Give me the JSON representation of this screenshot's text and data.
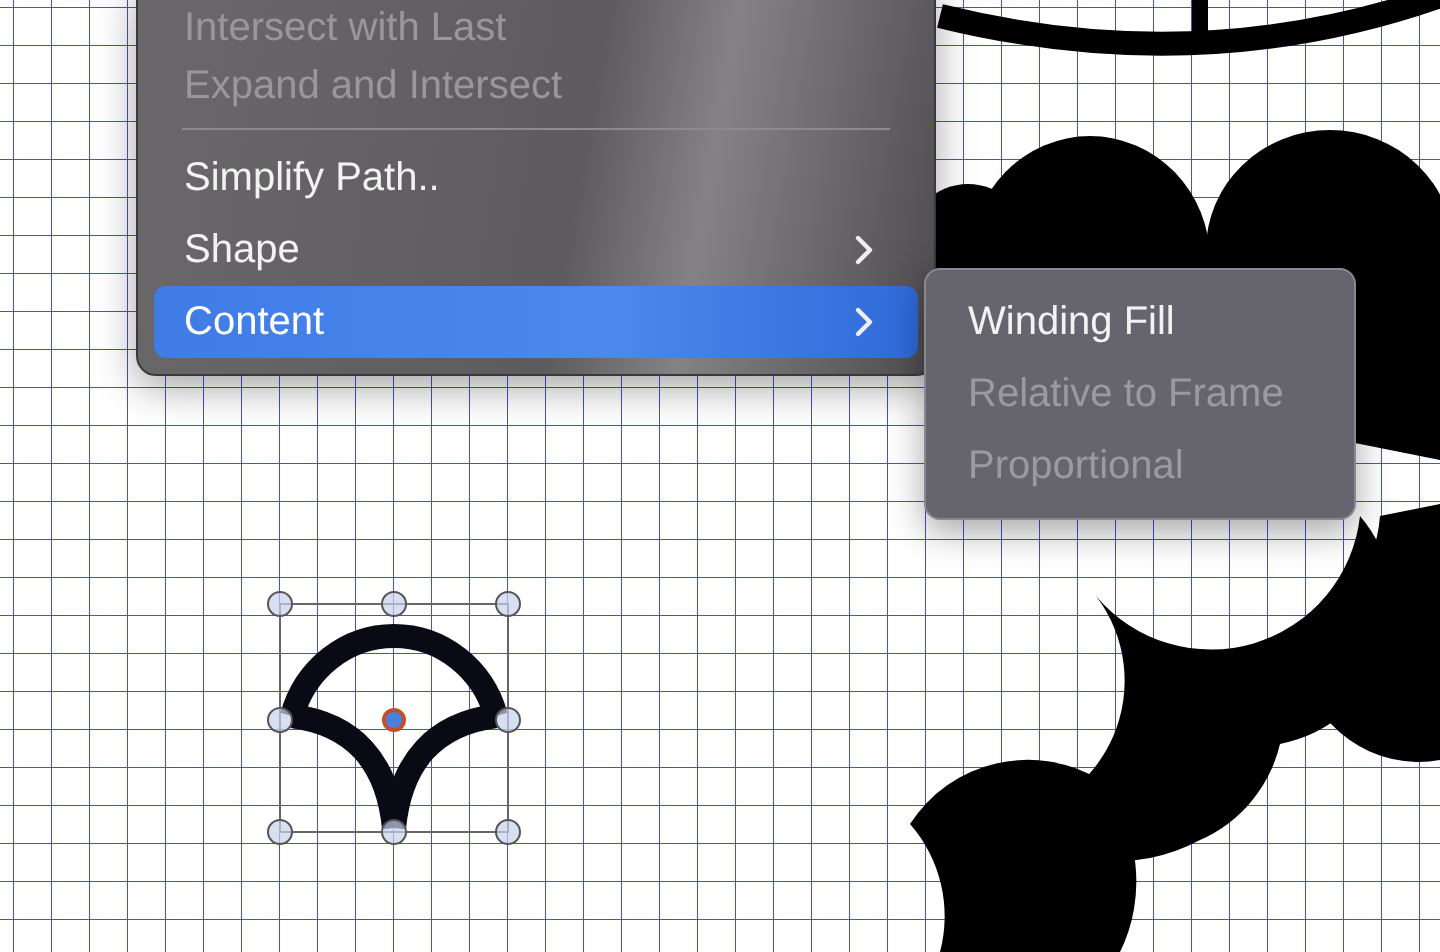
{
  "menu": {
    "items": [
      {
        "kind": "item",
        "label": "Intersect with Last",
        "disabled": true,
        "selected": false,
        "submenu": false
      },
      {
        "kind": "item",
        "label": "Expand and Intersect",
        "disabled": true,
        "selected": false,
        "submenu": false
      },
      {
        "kind": "separator"
      },
      {
        "kind": "item",
        "label": "Simplify Path..",
        "disabled": false,
        "selected": false,
        "submenu": false
      },
      {
        "kind": "item",
        "label": "Shape",
        "disabled": false,
        "selected": false,
        "submenu": true
      },
      {
        "kind": "item",
        "label": "Content",
        "disabled": false,
        "selected": true,
        "submenu": true
      }
    ]
  },
  "submenu": {
    "items": [
      {
        "label": "Winding Fill",
        "disabled": false
      },
      {
        "label": "Relative to Frame",
        "disabled": true
      },
      {
        "label": "Proportional",
        "disabled": true
      }
    ]
  }
}
